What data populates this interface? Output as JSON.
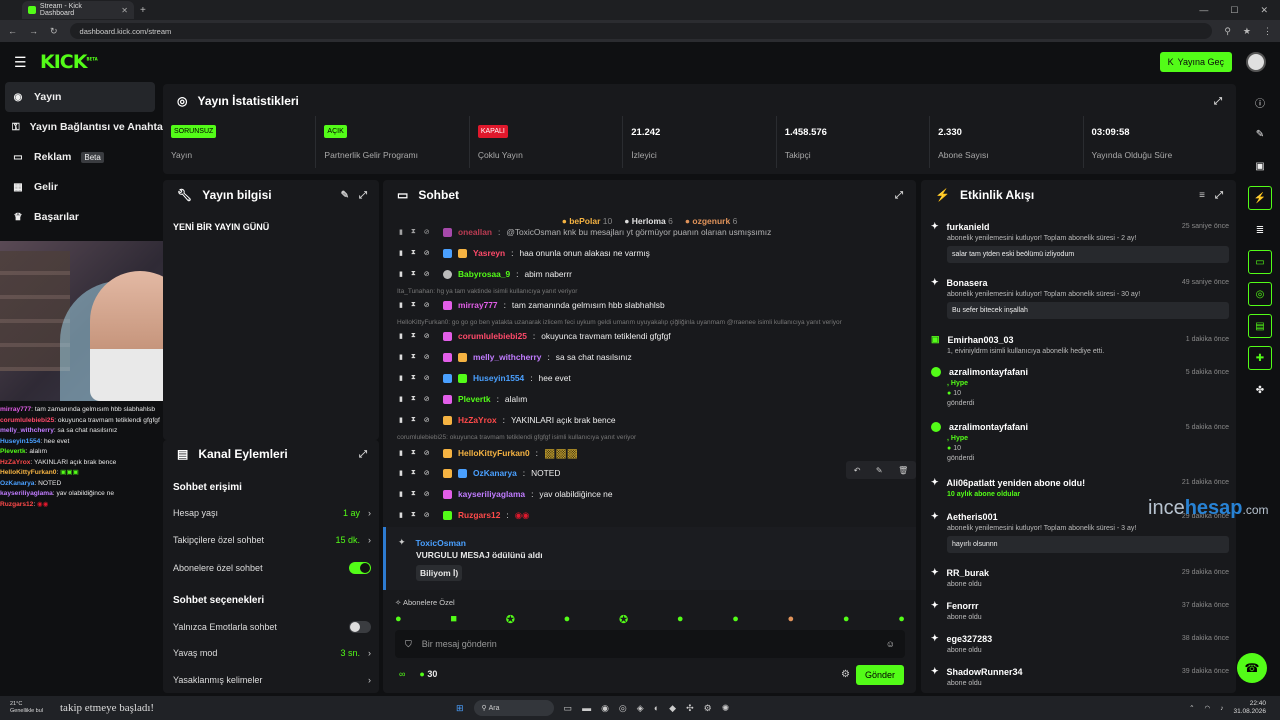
{
  "browser": {
    "tab_title": "Stream - Kick Dashboard",
    "url": "dashboard.kick.com/stream"
  },
  "header": {
    "logo": "KICK",
    "logo_tag": "BETA",
    "go_live": "Yayına Geç"
  },
  "sidebar": {
    "items": [
      {
        "label": "Yayın",
        "icon": "broadcast-icon"
      },
      {
        "label": "Yayın Bağlantısı ve Anahtarı",
        "icon": "key-icon"
      },
      {
        "label": "Reklam",
        "icon": "ad-icon",
        "badge": "Beta"
      },
      {
        "label": "Gelir",
        "icon": "revenue-icon"
      },
      {
        "label": "Başarılar",
        "icon": "trophy-icon"
      }
    ]
  },
  "overlay_chat": [
    {
      "user": "mirray777",
      "text": "tam zamanında gelmısım hbb slabhahlsb",
      "color": "#e25ee8"
    },
    {
      "user": "corumlulebiebi25",
      "text": "okuyunca travmam tetiklendi gfgfgf",
      "color": "#ff4a6a"
    },
    {
      "user": "melly_withcherry",
      "text": "sa sa chat nasılsınız",
      "color": "#c17cff"
    },
    {
      "user": "Huseyin1554",
      "text": "hee evet",
      "color": "#4aa0ff"
    },
    {
      "user": "Plevertk",
      "text": "alalım",
      "color": "#53fc18"
    },
    {
      "user": "HzZaYrox",
      "text": "YAKINLARI açık brak bence",
      "color": "#ff4a4a"
    },
    {
      "user": "HelloKittyFurkan0",
      "text": "",
      "color": "#f5b342"
    },
    {
      "user": "OzKanarya",
      "text": "NOTED",
      "color": "#4aa0ff"
    },
    {
      "user": "kayseriliyaglama",
      "text": "yav olabildiğince ne",
      "color": "#c17cff"
    },
    {
      "user": "Ruzgars12",
      "text": "",
      "color": "#ff4a4a"
    }
  ],
  "stats": {
    "title": "Yayın İstatistikleri",
    "cells": [
      {
        "badge": "SORUNSUZ",
        "label": "Yayın",
        "badge_color": "green"
      },
      {
        "badge": "AÇIK",
        "label": "Partnerlik Gelir Programı",
        "badge_color": "green"
      },
      {
        "badge": "KAPALI",
        "label": "Çoklu Yayın",
        "badge_color": "red"
      },
      {
        "value": "21.242",
        "label": "İzleyici"
      },
      {
        "value": "1.458.576",
        "label": "Takipçi"
      },
      {
        "value": "2.330",
        "label": "Abone Sayısı"
      },
      {
        "value": "03:09:58",
        "label": "Yayında Olduğu Süre"
      }
    ]
  },
  "stream_info": {
    "title": "Yayın bilgisi",
    "stream_title": "YENİ BİR YAYIN GÜNÜ"
  },
  "channel_actions": {
    "title": "Kanal Eylemleri",
    "chat_access": "Sohbet erişimi",
    "rows": [
      {
        "label": "Hesap yaşı",
        "value": "1 ay"
      },
      {
        "label": "Takipçilere özel sohbet",
        "value": "15 dk."
      },
      {
        "label": "Abonelere özel sohbet",
        "toggle": "on"
      }
    ],
    "chat_options": "Sohbet seçenekleri",
    "rows2": [
      {
        "label": "Yalnızca Emotlarla sohbet",
        "toggle": "off"
      },
      {
        "label": "Yavaş mod",
        "value": "3 sn."
      },
      {
        "label": "Yasaklanmış kelimeler",
        "value": ""
      }
    ]
  },
  "chat": {
    "title": "Sohbet",
    "top_gifters": [
      {
        "name": "bePolar",
        "count": "10",
        "color": "#f5b342"
      },
      {
        "name": "Herloma",
        "count": "6",
        "color": "#e0e0e0"
      },
      {
        "name": "ozgenurk",
        "count": "6",
        "color": "#e0935a"
      }
    ],
    "messages": [
      {
        "user": "oneallan",
        "text": "@ToxicOsman knk bu mesajları yt görmüyor puanın olarıan usmışsımız",
        "color": "#ff4a6a"
      },
      {
        "user": "Yasreyn",
        "text": "haa onunla onun alakası ne varmış",
        "color": "#ff4a6a"
      },
      {
        "user": "Babyrosaa_9",
        "text": "abim naberrr",
        "color": "#53fc18"
      },
      {
        "reply": "Ita_Tunahan: hg ya tam vaktinde isimli kullanıcıya yanıt veriyor"
      },
      {
        "user": "mirray777",
        "text": "tam zamanında gelmısım hbb slabhahlsb",
        "color": "#e25ee8"
      },
      {
        "reply": "HelloKittyFurkan0: go go go ben yatakta uzanarak izlicem feci uykum geldi umarım uyuyakalıp çiğliğinla uyanmam @rraenee isimli kullanıcıya yanıt veriyor"
      },
      {
        "user": "corumlulebiebi25",
        "text": "okuyunca travmam tetiklendi gfgfgf",
        "color": "#ff4a6a"
      },
      {
        "user": "melly_withcherry",
        "text": "sa sa chat nasılsınız",
        "color": "#c17cff"
      },
      {
        "user": "Huseyin1554",
        "text": "hee evet",
        "color": "#4aa0ff"
      },
      {
        "user": "Plevertk",
        "text": "alalım",
        "color": "#53fc18"
      },
      {
        "user": "HzZaYrox",
        "text": "YAKINLARI açık brak bence",
        "color": "#ff4a4a"
      },
      {
        "reply": "corumlulebiebi25: okuyunca travmam tetiklendi gfgfgf isimli kullanıcıya yanıt veriyor"
      },
      {
        "user": "HelloKittyFurkan0",
        "text": "",
        "color": "#f5b342"
      },
      {
        "user": "OzKanarya",
        "text": "NOTED",
        "color": "#4aa0ff"
      },
      {
        "user": "kayseriliyaglama",
        "text": "yav olabildiğince ne",
        "color": "#c17cff"
      },
      {
        "user": "Ruzgars12",
        "text": "",
        "color": "#ff4a4a"
      }
    ],
    "reward": {
      "user": "ToxicOsman",
      "text": "VURGULU MESAJ ödülünü aldı",
      "message": "Biliyom İ)"
    },
    "emotes_label": "Abonelere Özel",
    "input_placeholder": "Bir mesaj gönderin",
    "points": "30",
    "send": "Gönder"
  },
  "activity": {
    "title": "Etkinlik Akışı",
    "events": [
      {
        "user": "furkanield",
        "time": "25 saniye önce",
        "line": "abonelik yenilemesini kutluyor! Toplam abonelik süresi - 2 ay!",
        "msg": "salar tam ytden eski beölümü izliyodum"
      },
      {
        "user": "Bonasera",
        "time": "49 saniye önce",
        "line": "abonelik yenilemesini kutluyor! Toplam abonelik süresi - 30 ay!",
        "msg": "Bu sefer bitecek inşallah"
      },
      {
        "user": "Emirhan003_03",
        "time": "1 dakika önce",
        "line": "1, eiviniyldrm isimli kullanıcıya abonelik hediye etti."
      },
      {
        "user": "azralimontayfafani",
        "time": "5 dakika önce",
        "line": "Hype",
        "amount": "10",
        "sent": "gönderdi"
      },
      {
        "user": "azralimontayfafani",
        "time": "5 dakika önce",
        "line": "Hype",
        "amount": "10",
        "sent": "gönderdi"
      },
      {
        "user": "Ali06patlatt yeniden abone oldu!",
        "time": "21 dakika önce",
        "line": "10 aylık abone oldular"
      },
      {
        "user": "Aetheris001",
        "time": "29 dakika önce",
        "line": "abonelik yenilemesini kutluyor! Toplam abonelik süresi - 3 ay!",
        "msg": "hayırlı olsunnn"
      },
      {
        "user": "RR_burak",
        "time": "29 dakika önce",
        "line": "abone oldu"
      },
      {
        "user": "Fenorrr",
        "time": "37 dakika önce",
        "line": "abone oldu"
      },
      {
        "user": "ege327283",
        "time": "38 dakika önce",
        "line": "abone oldu"
      },
      {
        "user": "ShadowRunner34",
        "time": "39 dakika önce",
        "line": "abone oldu"
      }
    ]
  },
  "watermark": {
    "a": "ince",
    "b": "hesap",
    "c": ".com"
  },
  "taskbar": {
    "weather_temp": "21°C",
    "weather_desc": "Genellikle bul",
    "ticker": "takip etmeye başladı!",
    "search": "Ara",
    "time": "22:40",
    "date": "31.08.2026"
  }
}
